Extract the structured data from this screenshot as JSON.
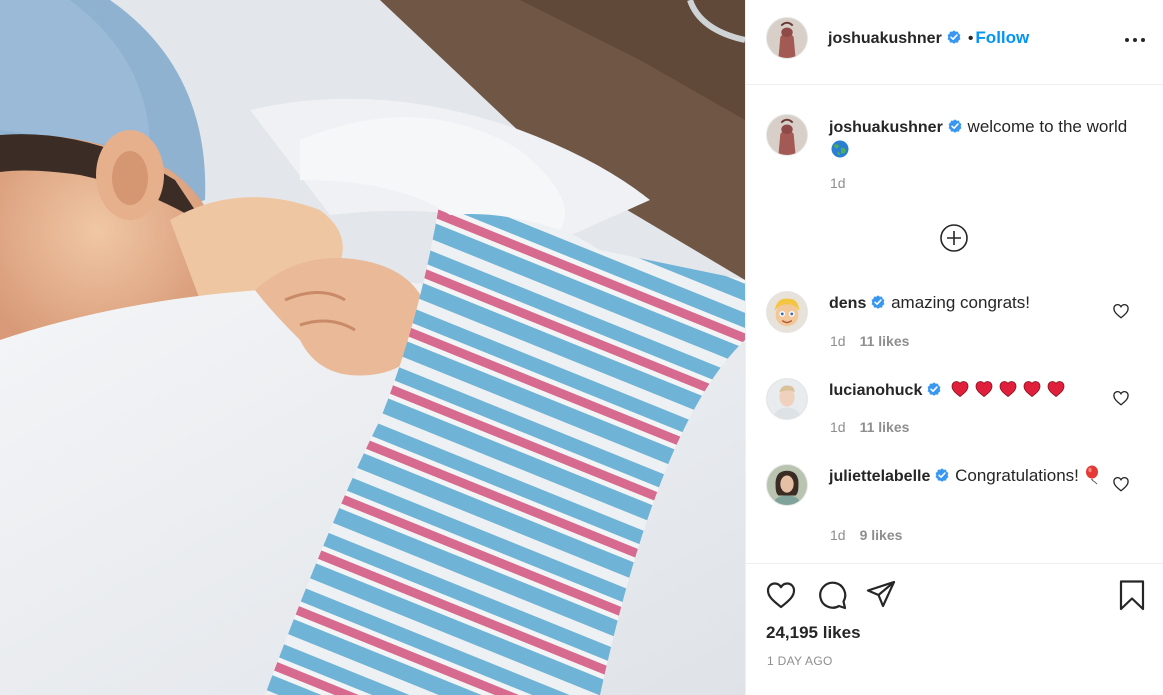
{
  "post": {
    "author": "joshuakushner",
    "verified": true,
    "follow_label": "Follow",
    "separator": "•",
    "caption": "welcome to the world",
    "caption_emoji": "globe-icon",
    "caption_time": "1d",
    "likes_count": "24,195 likes",
    "post_age": "1 DAY AGO"
  },
  "comments": [
    {
      "username": "dens",
      "text": "amazing congrats!",
      "time": "1d",
      "likes": "11 likes",
      "verified": true
    },
    {
      "username": "lucianohuck",
      "text": "",
      "emoji": [
        "red-heart",
        "red-heart",
        "red-heart",
        "red-heart",
        "red-heart"
      ],
      "time": "1d",
      "likes": "11 likes",
      "verified": true
    },
    {
      "username": "juliettelabelle",
      "text": "Congratulations!",
      "emoji": [
        "balloon"
      ],
      "time": "1d",
      "likes": "9 likes",
      "verified": true
    }
  ],
  "colors": {
    "accent": "#0095f6",
    "verified": "#3897f0",
    "muted": "#8e8e8e",
    "text": "#262626",
    "border": "#efefef"
  }
}
